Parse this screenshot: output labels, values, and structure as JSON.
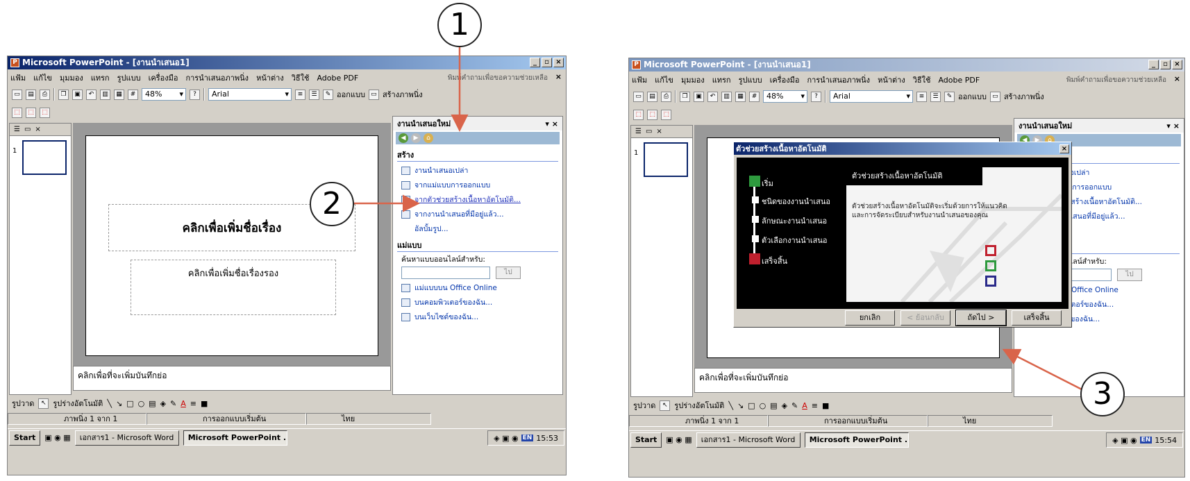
{
  "callouts": {
    "c1": "1",
    "c2": "2",
    "c3": "3"
  },
  "colors": {
    "arrow": "#d9644a",
    "titlebar_active": "#0a246a",
    "link": "#0033aa"
  },
  "common": {
    "menu": [
      "แฟ้ม",
      "แก้ไข",
      "มุมมอง",
      "แทรก",
      "รูปแบบ",
      "เครื่องมือ",
      "การนำเสนอภาพนิ่ง",
      "หน้าต่าง",
      "วิธีใช้",
      "Adobe PDF"
    ],
    "help_placeholder": "พิมพ์คำถามเพื่อขอความช่วยเหลือ",
    "zoom": "48%",
    "font": "Arial",
    "design_btn": "ออกแบบ",
    "new_slide_btn": "สร้างภาพนิ่ง",
    "slide_title": "คลิกเพื่อเพิ่มชื่อเรื่อง",
    "slide_subtitle": "คลิกเพื่อเพิ่มชื่อเรื่องรอง",
    "notes": "คลิกเพื่อที่จะเพิ่มบันทึกย่อ",
    "slide_num": "1",
    "draw_label": "รูปวาด",
    "autoshapes": "รูปร่างอัตโนมัติ",
    "status": {
      "slide": "ภาพนิ่ง 1 จาก 1",
      "design": "การออกแบบเริ่มต้น",
      "lang": "ไทย"
    },
    "taskbar": {
      "start": "Start",
      "word": "เอกสาร1 - Microsoft Word",
      "ppt": "Microsoft PowerPoint ...",
      "lang": "EN"
    },
    "taskpane": {
      "title": "งานนำเสนอใหม่",
      "sec_new": "สร้าง",
      "links": [
        "งานนำเสนอเปล่า",
        "จากแม่แบบการออกแบบ",
        "จากตัวช่วยสร้างเนื้อหาอัตโนมัติ...",
        "จากงานนำเสนอที่มีอยู่แล้ว...",
        "อัลบั้มรูป..."
      ],
      "sec_templates": "แม่แบบ",
      "search_label": "ค้นหาแบบออนไลน์สำหรับ:",
      "go": "ไป",
      "tlinks": [
        "แม่แบบบน Office Online",
        "บนคอมพิวเตอร์ของฉัน...",
        "บนเว็บไซต์ของฉัน..."
      ]
    }
  },
  "s1": {
    "title": "Microsoft PowerPoint - [งานนำเสนอ1]",
    "clock": "15:53"
  },
  "s2": {
    "title": "Microsoft PowerPoint - [งานนำเสนอ1]",
    "clock": "15:54",
    "dialog": {
      "title": "ตัวช่วยสร้างเนื้อหาอัตโนมัติ",
      "steps": [
        "เริ่ม",
        "ชนิดของงานนำเสนอ",
        "ลักษณะงานนำเสนอ",
        "ตัวเลือกงานนำเสนอ",
        "เสร็จสิ้น"
      ],
      "heading": "ตัวช่วยสร้างเนื้อหาอัตโนมัติ",
      "desc": "ตัวช่วยสร้างเนื้อหาอัตโนมัติจะเริ่มด้วยการให้แนวคิดและการจัดระเบียบสำหรับงานนำเสนอของคุณ",
      "buttons": {
        "cancel": "ยกเลิก",
        "back": "< ย้อนกลับ",
        "next": "ถัดไป >",
        "finish": "เสร็จสิ้น"
      }
    }
  }
}
